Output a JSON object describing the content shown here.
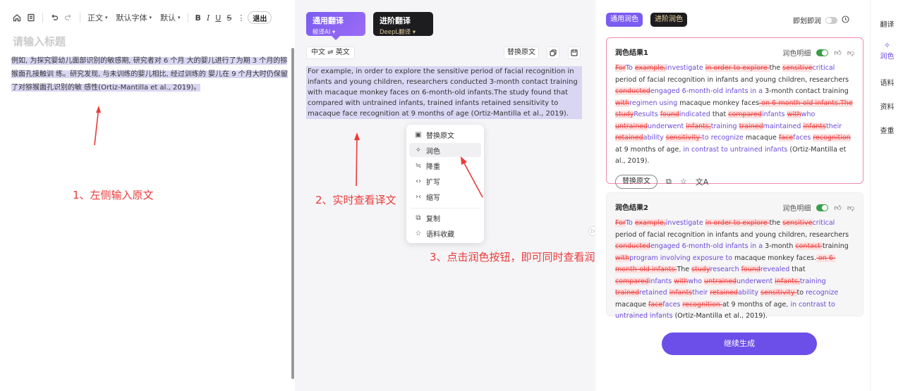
{
  "editor": {
    "toolbar": {
      "style_label": "正文",
      "font_label": "默认字体",
      "size_label": "默认",
      "bold": "B",
      "italic": "I",
      "underline": "U",
      "strike": "S",
      "more": "⋮",
      "exit_label": "退出"
    },
    "title_placeholder": "请输入标题",
    "source_text": "例如, 为探究婴幼儿面部识别的敏感期, 研究者对 6 个月 大的婴儿进行了为期 3 个月的猕猴面孔接触训 练。研究发现, 与未训练的婴儿相比, 经过训练的 婴儿在 9 个月大时仍保留了对猕猴面孔识别的敏 感性(Ortiz-Mantilla et al., 2019)。"
  },
  "annotations": {
    "step1": "1、左侧输入原文",
    "step2": "2、实时查看译文",
    "step3": "3、点击润色按钮，即可同时查看润色结果"
  },
  "translate": {
    "tabs": [
      {
        "title": "通用翻译",
        "subtitle": "鲸译AI ▾"
      },
      {
        "title": "进阶翻译",
        "subtitle": "DeepL翻译 ▾"
      }
    ],
    "lang_pair": "中文 ⇌ 英文",
    "replace_label": "替换原文",
    "result_text": "For example, in order to explore the sensitive period of facial recognition in infants and young children, researchers conducted 3-month contact training with macaque monkey faces on 6-month-old infants.The study found that compared with untrained infants, trained infants retained sensitivity to macaque face recognition at 9 months of age (Ortiz-Mantilla et al., 2019)."
  },
  "context_menu": {
    "items": [
      {
        "label": "替换原文",
        "icon": "replace-icon"
      },
      {
        "label": "润色",
        "icon": "sparkle-icon"
      },
      {
        "label": "降重",
        "icon": "reduce-icon"
      },
      {
        "label": "扩写",
        "icon": "expand-icon"
      },
      {
        "label": "缩写",
        "icon": "shrink-icon"
      },
      {
        "label": "复制",
        "icon": "copy-icon"
      },
      {
        "label": "语料收藏",
        "icon": "star-icon"
      }
    ]
  },
  "polish": {
    "tabs": [
      "通用润色",
      "进阶润色"
    ],
    "instant_label": "即划即润",
    "show_diff_label": "润色明细",
    "replace_label": "替换原文",
    "continue_label": "继续生成",
    "results": [
      {
        "title": "润色结果1",
        "segments": [
          [
            "d",
            "For"
          ],
          [
            "i",
            "To "
          ],
          [
            "d",
            "example,"
          ],
          [
            "i",
            "investigate "
          ],
          [
            "d",
            "in order to explore "
          ],
          [
            "n",
            "the "
          ],
          [
            "d",
            "sensitive"
          ],
          [
            "i",
            "critical"
          ],
          [
            "n",
            " period of facial recognition in infants and young children, researchers "
          ],
          [
            "d",
            "conducted"
          ],
          [
            "i",
            "engaged 6-month-old infants in a "
          ],
          [
            "n",
            "3-month contact training "
          ],
          [
            "d",
            "with"
          ],
          [
            "i",
            "regimen using"
          ],
          [
            "n",
            " macaque monkey faces"
          ],
          [
            "d",
            " on 6-month-old infants.The "
          ],
          [
            "d",
            "study"
          ],
          [
            "i",
            "Results "
          ],
          [
            "d",
            "found"
          ],
          [
            "i",
            "indicated"
          ],
          [
            "n",
            " that "
          ],
          [
            "d",
            "compared"
          ],
          [
            "i",
            "infants "
          ],
          [
            "d",
            "with"
          ],
          [
            "i",
            "who "
          ],
          [
            "d",
            "untrained"
          ],
          [
            "i",
            "underwent "
          ],
          [
            "d",
            "infants,"
          ],
          [
            "i",
            "training "
          ],
          [
            "d",
            "trained"
          ],
          [
            "i",
            "maintained "
          ],
          [
            "d",
            "infants"
          ],
          [
            "i",
            "their "
          ],
          [
            "d",
            "retained"
          ],
          [
            "i",
            "ability "
          ],
          [
            "d",
            "sensitivity "
          ],
          [
            "i",
            "to recognize "
          ],
          [
            "n",
            "macaque "
          ],
          [
            "d",
            "face"
          ],
          [
            "i",
            "faces "
          ],
          [
            "d",
            "recognition "
          ],
          [
            "n",
            "at 9 months of age"
          ],
          [
            "i",
            ", in contrast to untrained infants"
          ],
          [
            "n",
            " (Ortiz-Mantilla et al., 2019)."
          ]
        ]
      },
      {
        "title": "润色结果2",
        "segments": [
          [
            "d",
            "For"
          ],
          [
            "i",
            "To "
          ],
          [
            "d",
            "example,"
          ],
          [
            "i",
            "investigate "
          ],
          [
            "d",
            "in order to explore "
          ],
          [
            "n",
            "the "
          ],
          [
            "d",
            "sensitive"
          ],
          [
            "i",
            "critical"
          ],
          [
            "n",
            " period of facial recognition in infants and young children, researchers "
          ],
          [
            "d",
            "conducted"
          ],
          [
            "i",
            "engaged 6-month-old infants in a "
          ],
          [
            "n",
            "3-month "
          ],
          [
            "d",
            "contact "
          ],
          [
            "n",
            "training "
          ],
          [
            "d",
            "with"
          ],
          [
            "i",
            "program involving exposure to"
          ],
          [
            "n",
            " macaque monkey faces."
          ],
          [
            "d",
            " on 6-month-old infants."
          ],
          [
            "n",
            "The "
          ],
          [
            "d",
            "study"
          ],
          [
            "i",
            "research "
          ],
          [
            "d",
            "found"
          ],
          [
            "i",
            "revealed"
          ],
          [
            "n",
            " that "
          ],
          [
            "d",
            "compared"
          ],
          [
            "i",
            "infants "
          ],
          [
            "d",
            "with"
          ],
          [
            "i",
            "who "
          ],
          [
            "d",
            "untrained"
          ],
          [
            "i",
            "underwent "
          ],
          [
            "d",
            "infants,"
          ],
          [
            "i",
            "training "
          ],
          [
            "d",
            "trained"
          ],
          [
            "i",
            "retained "
          ],
          [
            "d",
            "infants"
          ],
          [
            "i",
            "their "
          ],
          [
            "d",
            "retained"
          ],
          [
            "i",
            "ability "
          ],
          [
            "d",
            "sensitivity "
          ],
          [
            "n",
            "to "
          ],
          [
            "i",
            "recognize "
          ],
          [
            "n",
            "macaque "
          ],
          [
            "d",
            "face"
          ],
          [
            "i",
            "faces "
          ],
          [
            "d",
            "recognition "
          ],
          [
            "n",
            "at 9 months of age"
          ],
          [
            "i",
            ", in contrast to untrained infants"
          ],
          [
            "n",
            " (Ortiz-Mantilla et al., 2019)."
          ]
        ]
      }
    ]
  },
  "sidebar": {
    "items": [
      "翻译",
      "润色",
      "语料",
      "资料",
      "查重"
    ]
  },
  "colors": {
    "accent": "#6c4ee8",
    "delete": "#e44444",
    "insert": "#6c4ad8",
    "annotation": "#ea3b3b"
  }
}
